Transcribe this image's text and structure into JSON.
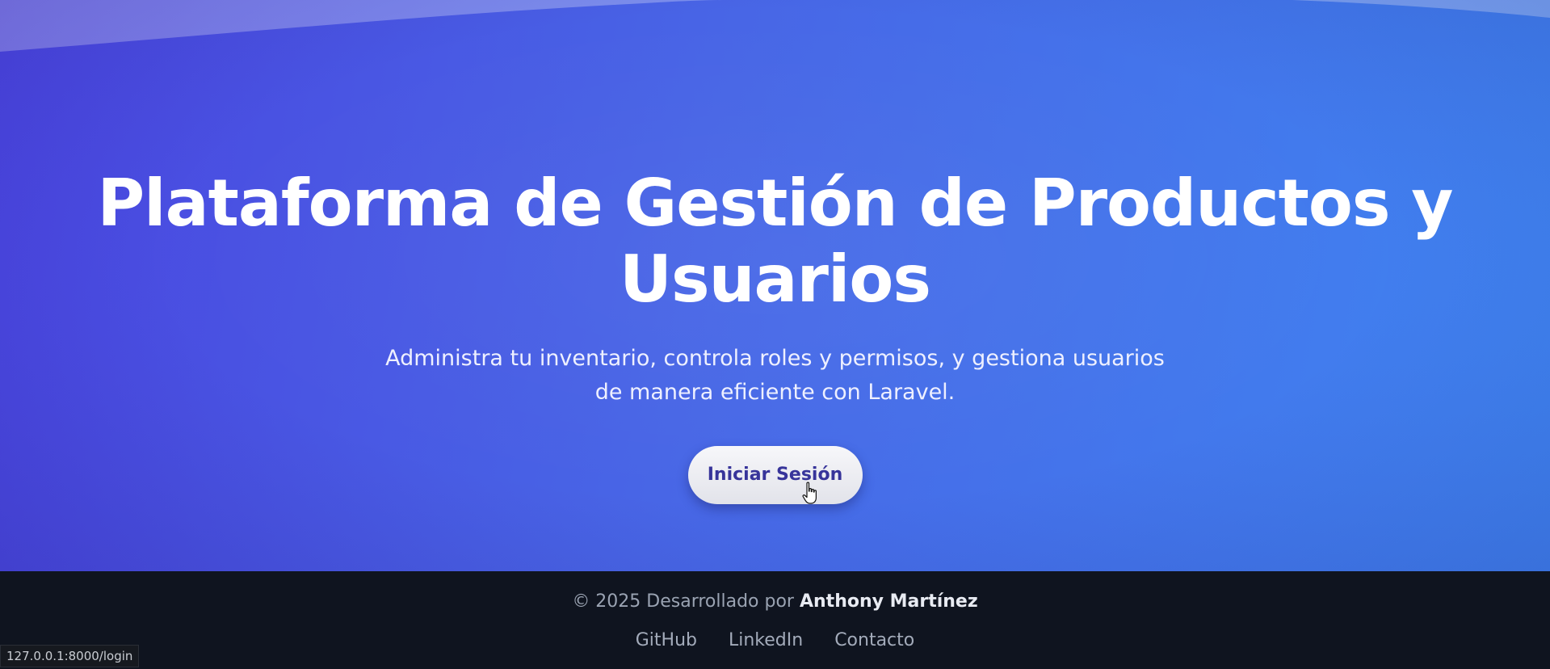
{
  "hero": {
    "title": "Plataforma de Gestión de Productos y Usuarios",
    "subtitle": "Administra tu inventario, controla roles y permisos, y gestiona usuarios de manera eficiente con Laravel.",
    "login_button_label": "Iniciar Sesión"
  },
  "footer": {
    "copyright_prefix": "© 2025 Desarrollado por",
    "author": "Anthony Martínez",
    "links": [
      "GitHub",
      "LinkedIn",
      "Contacto"
    ]
  },
  "status_bar": {
    "url": "127.0.0.1:8000/login"
  },
  "colors": {
    "hero_gradient_start": "#4a45e0",
    "hero_gradient_end": "#3f85f1",
    "footer_background": "#0f141f",
    "button_text": "#37349a"
  },
  "icons": {
    "cursor": "hand-pointer-icon"
  }
}
